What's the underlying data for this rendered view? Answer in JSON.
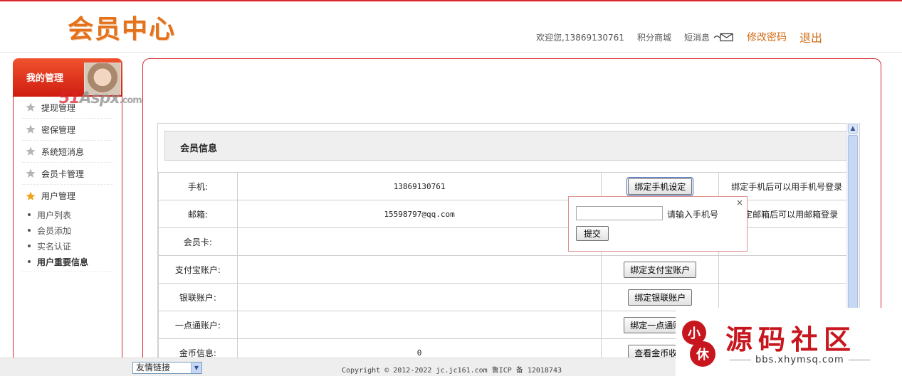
{
  "header": {
    "logo": "会员中心",
    "welcome": "欢迎您,13869130761",
    "points_mall": "积分商城",
    "messages": "短消息",
    "change_password": "修改密码",
    "logout": "退出"
  },
  "sidebar": {
    "title": "我的管理",
    "items": [
      {
        "label": "提现管理"
      },
      {
        "label": "密保管理"
      },
      {
        "label": "系统短消息"
      },
      {
        "label": "会员卡管理"
      },
      {
        "label": "用户管理"
      }
    ],
    "subitems": [
      {
        "label": "用户列表"
      },
      {
        "label": "会员添加"
      },
      {
        "label": "实名认证"
      },
      {
        "label": "用户重要信息"
      }
    ],
    "watermark_red": "51",
    "watermark_gray": "Aspx",
    "watermark_suffix": ".com"
  },
  "main": {
    "section_title": "会员信息",
    "rows": [
      {
        "label": "手机:",
        "value": "13869130761",
        "button": "绑定手机设定",
        "note": "绑定手机后可以用手机号登录"
      },
      {
        "label": "邮箱:",
        "value": "15598797@qq.com",
        "button": "",
        "note": "绑定邮箱后可以用邮箱登录"
      },
      {
        "label": "会员卡:",
        "value": "",
        "button": "",
        "note": ""
      },
      {
        "label": "支付宝账户:",
        "value": "",
        "button": "绑定支付宝账户",
        "note": ""
      },
      {
        "label": "银联账户:",
        "value": "",
        "button": "绑定银联账户",
        "note": ""
      },
      {
        "label": "一点通账户:",
        "value": "",
        "button": "绑定一点通账户",
        "note": ""
      },
      {
        "label": "金币信息:",
        "value": "0",
        "button": "查看金币收入",
        "note": ""
      }
    ]
  },
  "popup": {
    "close": "×",
    "input_value": "",
    "hint": "请输入手机号",
    "submit": "提交"
  },
  "footer": {
    "friend_links": "友情链接",
    "copyright": "Copyright © 2012-2022 jc.jc161.com 鲁ICP 备 12018743"
  },
  "brand": {
    "name": "源码社区",
    "url": "bbs.xhymsq.com",
    "mark_text": "小 休"
  },
  "colors": {
    "accent_red": "#d9252c",
    "logo_orange": "#e2721e",
    "link_orange": "#d26a12"
  }
}
